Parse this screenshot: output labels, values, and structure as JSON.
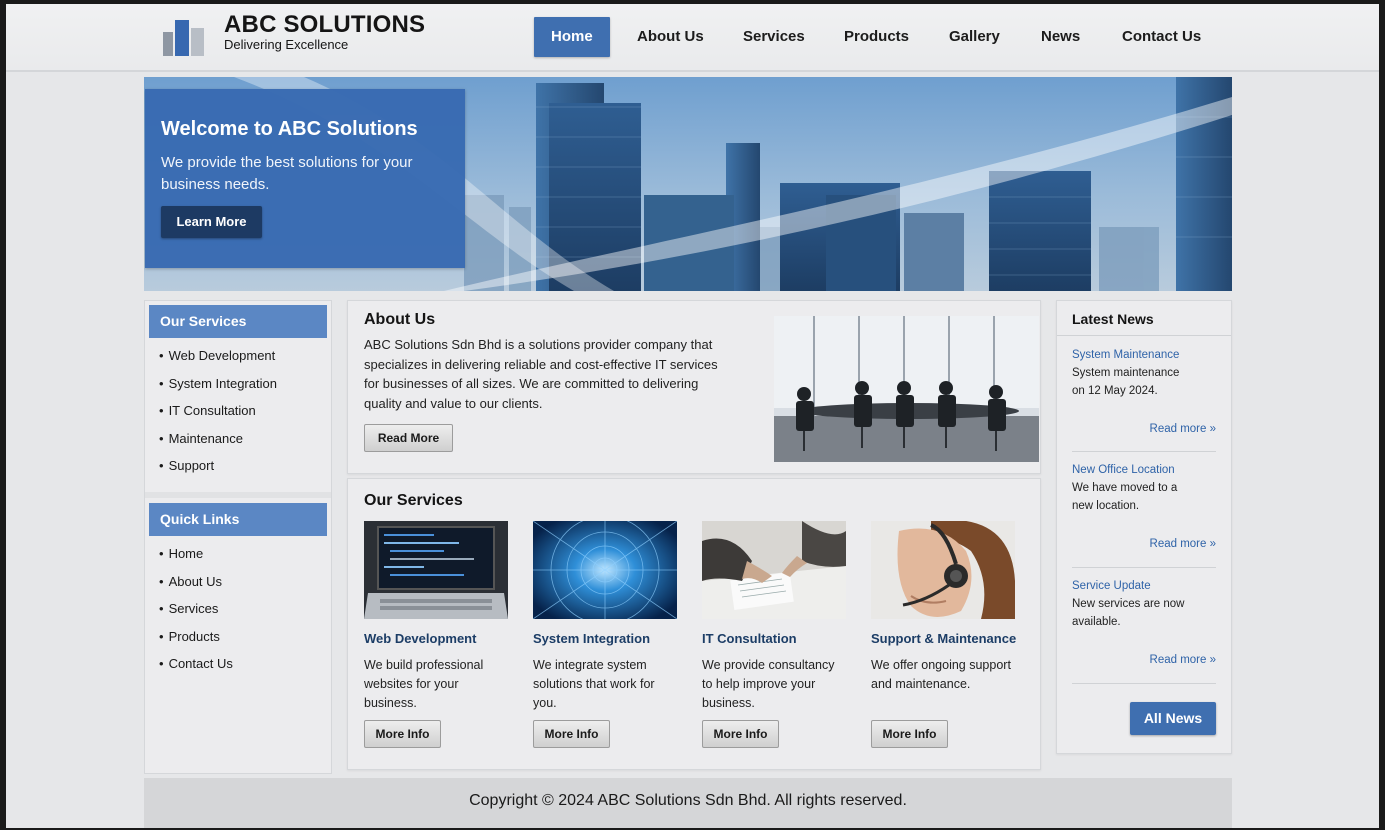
{
  "brand": {
    "name": "ABC SOLUTIONS",
    "tagline": "Delivering Excellence"
  },
  "nav": {
    "items": [
      "Home",
      "About Us",
      "Services",
      "Products",
      "Gallery",
      "News",
      "Contact Us"
    ],
    "active": "Home"
  },
  "hero": {
    "title": "Welcome to ABC Solutions",
    "text": "We provide the best solutions for your business needs.",
    "button": "Learn More"
  },
  "sidebar": {
    "services_title": "Our Services",
    "services": [
      "Web Development",
      "System Integration",
      "IT Consultation",
      "Maintenance",
      "Support"
    ],
    "links_title": "Quick Links",
    "links": [
      "Home",
      "About Us",
      "Services",
      "Products",
      "Contact Us"
    ]
  },
  "about": {
    "title": "About Us",
    "text": "ABC Solutions Sdn Bhd is a solutions provider company that specializes in delivering reliable and cost-effective IT services for businesses of all sizes. We are committed to delivering quality and value to our clients.",
    "button": "Read More"
  },
  "services": {
    "title": "Our Services",
    "cards": [
      {
        "title": "Web Development",
        "desc": "We build professional websites for your business.",
        "button": "More Info"
      },
      {
        "title": "System Integration",
        "desc": "We integrate system solutions that work for you.",
        "button": "More Info"
      },
      {
        "title": "IT Consultation",
        "desc": "We provide consultancy to help improve your business.",
        "button": "More Info"
      },
      {
        "title": "Support & Maintenance",
        "desc": "We offer ongoing support and maintenance.",
        "button": "More Info"
      }
    ]
  },
  "news": {
    "title": "Latest News",
    "items": [
      {
        "title": "System Maintenance",
        "text": "System maintenance on 12 May 2024.",
        "more": "Read more »"
      },
      {
        "title": "New Office Location",
        "text": "We have moved to a new location.",
        "more": "Read more »"
      },
      {
        "title": "Service Update",
        "text": "New services are now available.",
        "more": "Read more »"
      }
    ],
    "button": "All News"
  },
  "footer": {
    "text": "Copyright © 2024 ABC Solutions Sdn Bhd. All rights reserved."
  },
  "colors": {
    "primary": "#3f6fb0",
    "sidebar_header": "#5b87c4",
    "dark_button": "#1d3a63",
    "link": "#2f63a8"
  }
}
